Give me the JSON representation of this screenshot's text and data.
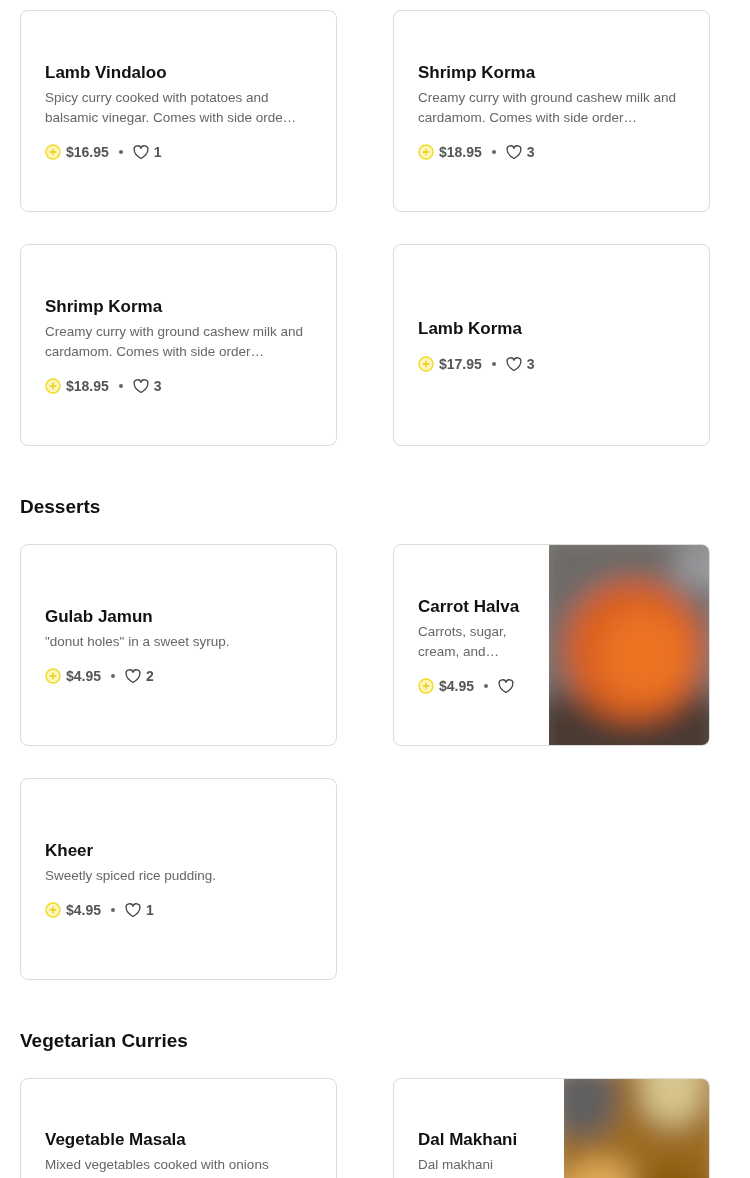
{
  "sections": [
    {
      "items": [
        {
          "name": "Lamb Vindaloo",
          "description": "Spicy curry cooked with potatoes and balsamic vinegar. Comes with side orde…",
          "price": "$16.95",
          "likes": "1"
        },
        {
          "name": "Shrimp Korma",
          "description": "Creamy curry with ground cashew milk and cardamom. Comes with side order…",
          "price": "$18.95",
          "likes": "3"
        },
        {
          "name": "Shrimp Korma",
          "description": "Creamy curry with ground cashew milk and cardamom. Comes with side order…",
          "price": "$18.95",
          "likes": "3"
        },
        {
          "name": "Lamb Korma",
          "price": "$17.95",
          "likes": "3"
        }
      ]
    },
    {
      "title": "Desserts",
      "items": [
        {
          "name": "Gulab Jamun",
          "description": "\"donut holes\" in a sweet syrup.",
          "price": "$4.95",
          "likes": "2"
        },
        {
          "name": "Carrot Halva",
          "description": "Carrots, sugar, cream, and…",
          "price": "$4.95"
        },
        {
          "name": "Kheer",
          "description": "Sweetly spiced rice pudding.",
          "price": "$4.95",
          "likes": "1"
        }
      ]
    },
    {
      "title": "Vegetarian Curries",
      "items": [
        {
          "name": "Vegetable Masala",
          "description": "Mixed vegetables cooked with onions"
        },
        {
          "name": "Dal Makhani",
          "description": "Dal makhani"
        }
      ]
    }
  ]
}
